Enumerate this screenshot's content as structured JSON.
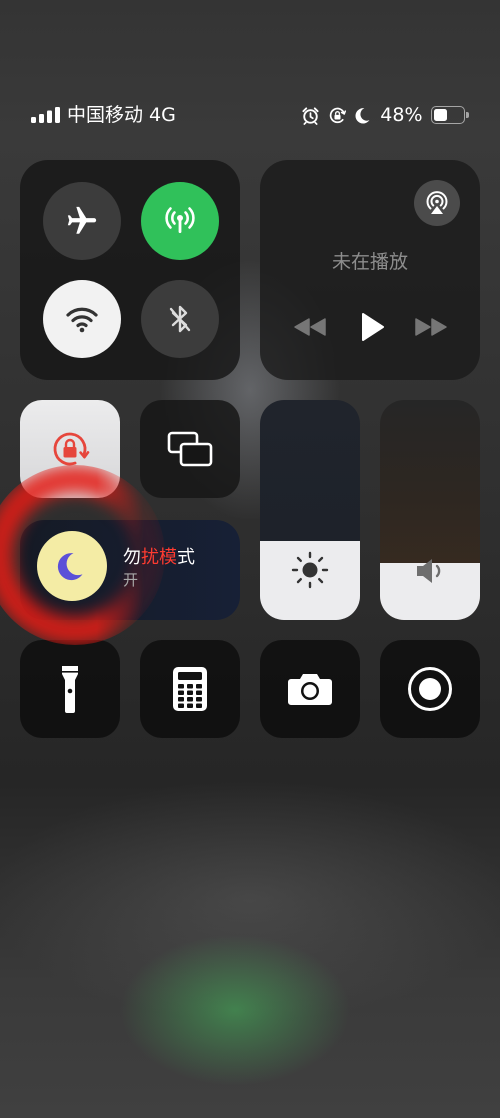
{
  "status_bar": {
    "carrier": "中国移动",
    "network": "4G",
    "battery_text": "48%",
    "battery_level": 0.48,
    "signal_bars": 4,
    "icons": [
      "cellular-signal-icon",
      "alarm-icon",
      "orientation-lock-status-icon",
      "moon-icon",
      "battery-icon"
    ]
  },
  "connectivity": {
    "airplane_mode": {
      "icon": "airplane-icon",
      "on": false
    },
    "cellular_data": {
      "icon": "antenna-icon",
      "on": true
    },
    "wifi": {
      "icon": "wifi-icon",
      "on": true
    },
    "bluetooth": {
      "icon": "bluetooth-off-icon",
      "on": false
    }
  },
  "now_playing": {
    "status": "未在播放",
    "icons": {
      "airplay": "airplay-audio-icon",
      "previous": "rewind-icon",
      "play": "play-icon",
      "next": "fast-forward-icon"
    }
  },
  "orientation_lock": {
    "icon": "orientation-lock-icon",
    "on": true
  },
  "screen_mirroring": {
    "icon": "screen-mirroring-icon"
  },
  "brightness": {
    "icon": "sun-icon",
    "level": 0.36
  },
  "volume": {
    "icon": "speaker-icon",
    "level": 0.26
  },
  "do_not_disturb": {
    "title": "勿扰模式",
    "state": "开",
    "on": true,
    "icon": "moon-icon"
  },
  "shortcuts": [
    {
      "icon": "flashlight-icon"
    },
    {
      "icon": "calculator-icon"
    },
    {
      "icon": "camera-icon"
    },
    {
      "icon": "screen-record-icon"
    }
  ],
  "colors": {
    "active_green": "#30c15a",
    "dnd_circle": "#f4eca5",
    "dnd_moon": "#5b50d8",
    "orientation_red": "#e6463c",
    "annotation_red": "#e41c16"
  }
}
